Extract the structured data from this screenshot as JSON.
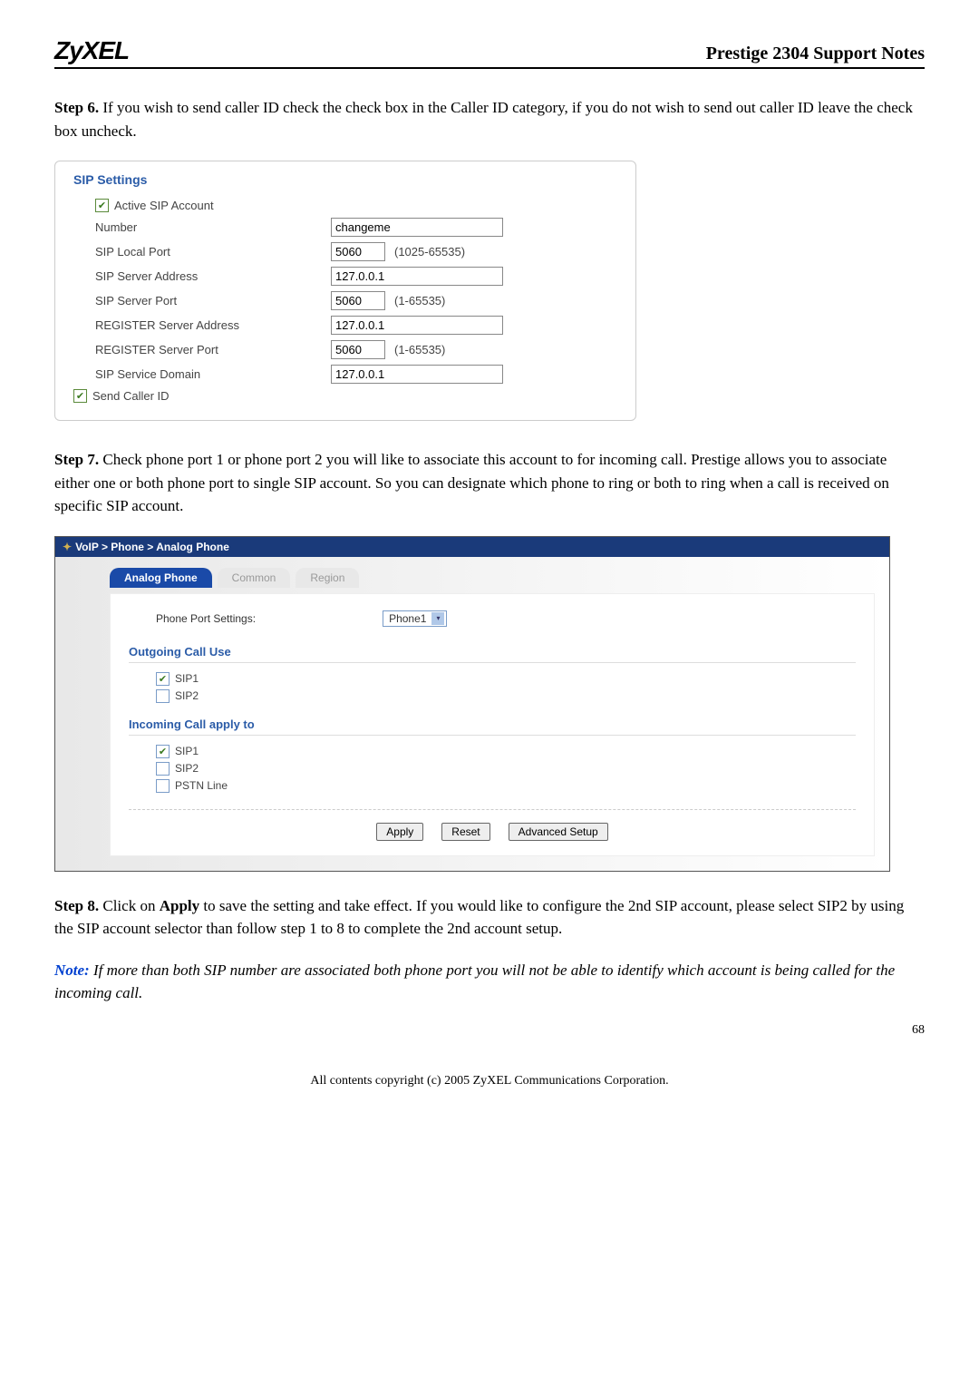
{
  "header": {
    "brand": "ZyXEL",
    "title": "Prestige 2304 Support Notes"
  },
  "step6": {
    "lead": "Step 6.",
    "text": " If you wish to send caller ID check the check box in the Caller ID category, if you do not wish to send out caller ID leave the check box uncheck."
  },
  "sip": {
    "heading": "SIP Settings",
    "active_label": "Active SIP Account",
    "rows": {
      "number_label": "Number",
      "number_value": "changeme",
      "local_port_label": "SIP Local Port",
      "local_port_value": "5060",
      "local_port_range": "(1025-65535)",
      "server_addr_label": "SIP Server Address",
      "server_addr_value": "127.0.0.1",
      "server_port_label": "SIP Server Port",
      "server_port_value": "5060",
      "server_port_range": "(1-65535)",
      "reg_addr_label": "REGISTER Server Address",
      "reg_addr_value": "127.0.0.1",
      "reg_port_label": "REGISTER Server Port",
      "reg_port_value": "5060",
      "reg_port_range": "(1-65535)",
      "service_domain_label": "SIP Service Domain",
      "service_domain_value": "127.0.0.1",
      "send_caller_label": "Send Caller ID"
    }
  },
  "step7": {
    "lead": "Step 7.",
    "text": " Check phone port 1 or phone port 2 you will like to associate this account to for incoming call.  Prestige allows you to associate either one or both phone port to single SIP account.  So you can designate which phone to ring or both to ring when a call is received on specific SIP account."
  },
  "voip": {
    "breadcrumb": "VoIP > Phone > Analog Phone",
    "tabs": {
      "analog": "Analog Phone",
      "common": "Common",
      "region": "Region"
    },
    "phone_port_label": "Phone Port Settings:",
    "phone_port_value": "Phone1",
    "outgoing_head": "Outgoing Call Use",
    "incoming_head": "Incoming Call apply to",
    "sip1": "SIP1",
    "sip2": "SIP2",
    "pstn": "PSTN Line",
    "buttons": {
      "apply": "Apply",
      "reset": "Reset",
      "advanced": "Advanced Setup"
    }
  },
  "step8": {
    "lead": "Step 8.",
    "text_a": "  Click on ",
    "apply": "Apply",
    "text_b": " to save the setting and take effect.  If you would like to configure the 2nd SIP account, please select SIP2 by using the SIP account selector than follow step 1 to 8 to complete the 2nd account setup."
  },
  "note": {
    "lead": "Note:",
    "text": " If more than both SIP number are associated both phone port you will not be able to identify which account is being called for the incoming call."
  },
  "footer": {
    "copyright": "All contents copyright (c) 2005 ZyXEL Communications Corporation.",
    "page": "68"
  }
}
